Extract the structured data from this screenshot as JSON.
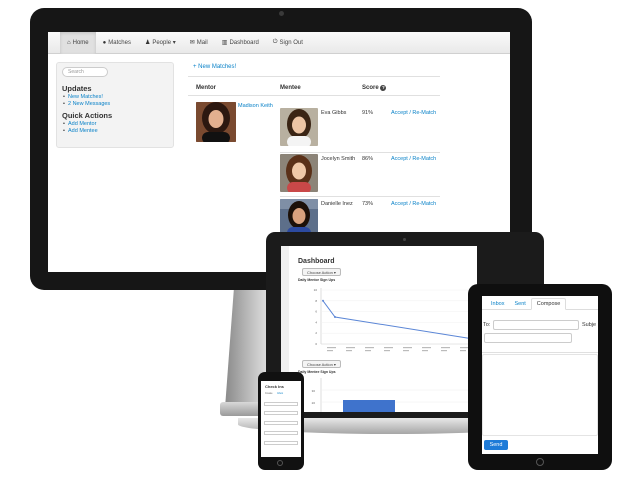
{
  "colors": {
    "link": "#0a82c8",
    "device_dark": "#161616",
    "chart_line": "#5b86d6",
    "bar": "#3f73cc",
    "send": "#1e7bd8"
  },
  "desktop": {
    "nav": [
      {
        "icon": "home-icon",
        "glyph": "⌂",
        "label": "Home",
        "active": true
      },
      {
        "icon": "info-icon",
        "glyph": "●",
        "label": "Matches"
      },
      {
        "icon": "person-icon",
        "glyph": "♟",
        "label": "People ▾"
      },
      {
        "icon": "mail-icon",
        "glyph": "✉",
        "label": "Mail"
      },
      {
        "icon": "chart-icon",
        "glyph": "▥",
        "label": "Dashboard"
      },
      {
        "icon": "power-icon",
        "glyph": "⏻",
        "label": "Sign Out"
      }
    ],
    "search_placeholder": "Search",
    "updates_heading": "Updates",
    "updates": [
      "New Matches!",
      "2 New Messages"
    ],
    "quick_actions_heading": "Quick Actions",
    "quick_actions": [
      "Add Mentor",
      "Add Mentee"
    ],
    "new_matches_link": "+ New Matches!",
    "columns": {
      "mentor": "Mentor",
      "mentee": "Mentee",
      "score": "Score"
    },
    "mentor_name": "Madison Keith",
    "rows": [
      {
        "mentee": "Eva Gibbs",
        "score": "91%",
        "action": "Accept / Re-Match"
      },
      {
        "mentee": "Jocelyn Smith",
        "score": "86%",
        "action": "Accept / Re-Match"
      },
      {
        "mentee": "Danielle Inez",
        "score": "73%",
        "action": "Accept / Re-Match"
      }
    ]
  },
  "laptop": {
    "title": "Dashboard",
    "action_button": "Choose Action ▾",
    "chart1_label": "Daily Mentor Sign Ups",
    "chart2_label": "Daily Mentee Sign Ups"
  },
  "chart_data": [
    {
      "type": "line",
      "title": "Daily Mentor Sign Ups",
      "series": [
        {
          "values": [
            8,
            5,
            1
          ]
        }
      ],
      "ylim": [
        0,
        10
      ],
      "y_ticks": [
        "10",
        "8",
        "6",
        "4",
        "2",
        "0"
      ]
    },
    {
      "type": "bar",
      "title": "Daily Mentee Sign Ups",
      "y_ticks": [
        "30",
        "20"
      ]
    }
  ],
  "tablet": {
    "tabs": [
      "Inbox",
      "Sent",
      "Compose"
    ],
    "active_tab": "Compose",
    "to_label": "To:",
    "subject_label": "Subje",
    "send_label": "Send"
  },
  "phone": {
    "title": "Check Ins",
    "tabs": [
      "Create",
      "Inbox"
    ]
  }
}
